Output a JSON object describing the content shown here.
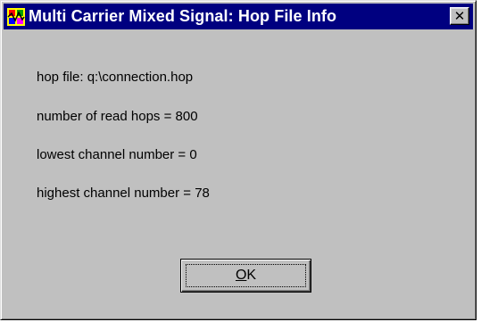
{
  "window": {
    "title": "Multi Carrier Mixed Signal: Hop File Info",
    "close_glyph": "✕",
    "icon": "app-icon"
  },
  "info": {
    "hop_file": "hop file: q:\\connection.hop",
    "read_hops": "number of read hops = 800",
    "lowest_channel": "lowest channel number = 0",
    "highest_channel": "highest channel number = 78"
  },
  "buttons": {
    "ok_mnemonic": "O",
    "ok_rest": "K"
  },
  "colors": {
    "titlebar": "#000080",
    "face": "#c0c0c0"
  }
}
